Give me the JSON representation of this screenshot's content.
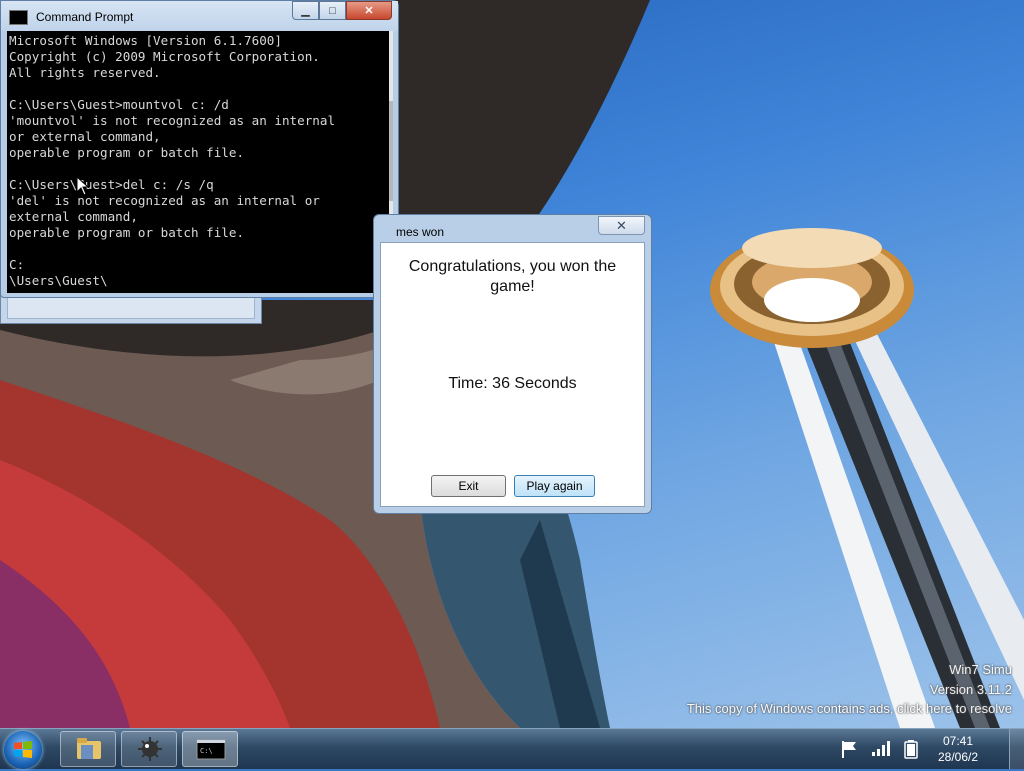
{
  "command_prompt": {
    "title": "Command Prompt",
    "console_lines": [
      "Microsoft Windows [Version 6.1.7600]",
      "Copyright (c) 2009 Microsoft Corporation.",
      "All rights reserved.",
      "",
      "C:\\Users\\Guest>mountvol c: /d",
      "'mountvol' is not recognized as an internal",
      "or external command,",
      "operable program or batch file.",
      "",
      "C:\\Users\\Guest>del c: /s /q",
      "'del' is not recognized as an internal or",
      "external command,",
      "operable program or batch file.",
      "",
      "C:",
      "\\Users\\Guest\\"
    ]
  },
  "game_dialog": {
    "title": "mes won",
    "message": "Congratulations, you won the game!",
    "time_text": "Time: 36 Seconds",
    "exit_label": "Exit",
    "play_again_label": "Play again"
  },
  "watermark": {
    "line1": "Win7 Simu",
    "line2": "Version 3.11.2",
    "line3": "This copy of Windows contains ads, click here to resolve"
  },
  "taskbar": {
    "clock_time": "07:41",
    "clock_date": "28/06/2"
  }
}
